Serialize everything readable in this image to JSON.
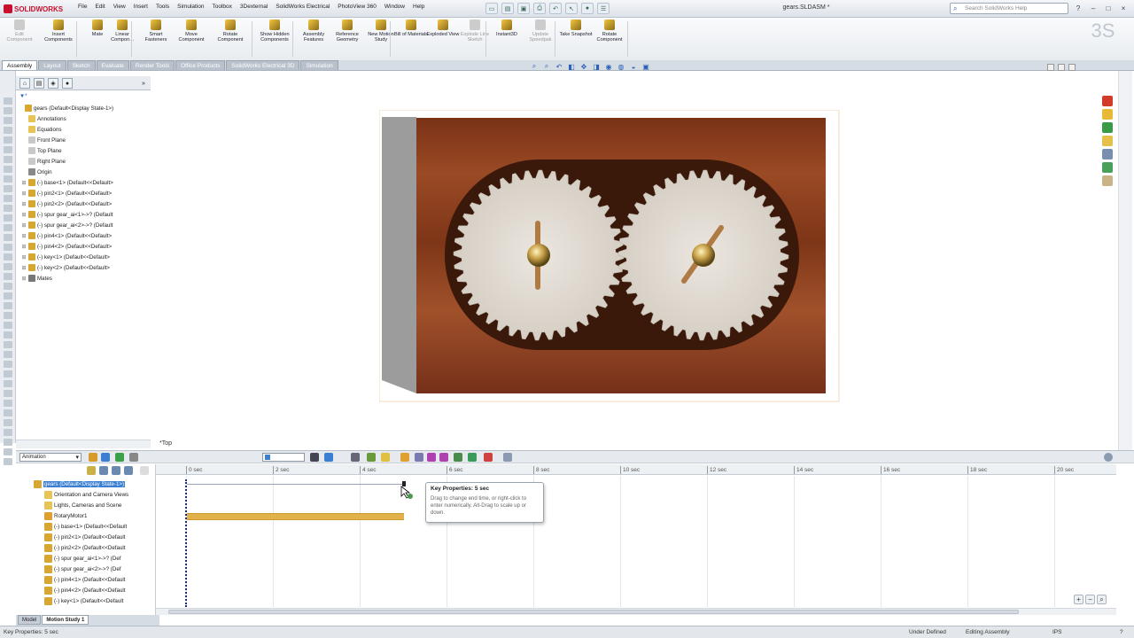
{
  "app": {
    "logo": "SOLIDWORKS",
    "menu": [
      "File",
      "Edit",
      "View",
      "Insert",
      "Tools",
      "Simulation",
      "Toolbox",
      "3Dexternal",
      "SolidWorks Electrical",
      "PhotoView 360",
      "Window",
      "Help"
    ],
    "document_title": "gears.SLDASM *",
    "search_placeholder": "Search SolidWorks Help"
  },
  "ribbon": {
    "buttons": [
      {
        "label": "Edit Component",
        "disabled": true
      },
      {
        "label": "Insert Components",
        "disabled": false
      },
      {
        "label": "Mate",
        "disabled": false
      },
      {
        "label": "Linear Compon...",
        "disabled": false
      },
      {
        "label": "Smart Fasteners",
        "disabled": false
      },
      {
        "label": "Move Component",
        "disabled": false
      },
      {
        "label": "Rotate Component",
        "disabled": false
      },
      {
        "label": "Show Hidden Components",
        "disabled": false
      },
      {
        "label": "Assembly Features",
        "disabled": false
      },
      {
        "label": "Reference Geometry",
        "disabled": false
      },
      {
        "label": "New Motion Study",
        "disabled": false
      },
      {
        "label": "Bill of Materials",
        "disabled": false
      },
      {
        "label": "Exploded View",
        "disabled": false
      },
      {
        "label": "Explode Line Sketch",
        "disabled": true
      },
      {
        "label": "Instant3D",
        "disabled": false
      },
      {
        "label": "Update Speedpak",
        "disabled": true
      },
      {
        "label": "Take Snapshot",
        "disabled": false
      },
      {
        "label": "Rotate Component",
        "disabled": false
      }
    ]
  },
  "tabs": [
    {
      "label": "Assembly",
      "active": true
    },
    {
      "label": "Layout",
      "active": false
    },
    {
      "label": "Sketch",
      "active": false
    },
    {
      "label": "Evaluate",
      "active": false
    },
    {
      "label": "Render Tools",
      "active": false
    },
    {
      "label": "Office Products",
      "active": false
    },
    {
      "label": "SolidWorks Electrical 3D",
      "active": false
    },
    {
      "label": "Simulation",
      "active": false
    }
  ],
  "feature_tree": {
    "filter": "▼*",
    "items": [
      {
        "label": "gears  (Default<Display State-1>)",
        "level": 0
      },
      {
        "label": "Annotations",
        "level": 1
      },
      {
        "label": "Equations",
        "level": 1
      },
      {
        "label": "Front Plane",
        "level": 1
      },
      {
        "label": "Top Plane",
        "level": 1
      },
      {
        "label": "Right Plane",
        "level": 1
      },
      {
        "label": "Origin",
        "level": 1
      },
      {
        "label": "(-) base<1> (Default<<Default>",
        "level": 1
      },
      {
        "label": "(-) pin2<1> (Default<<Default>",
        "level": 1
      },
      {
        "label": "(-) pin2<2> (Default<<Default>",
        "level": 1
      },
      {
        "label": "(-) spur gear_ai<1>->? (Default",
        "level": 1
      },
      {
        "label": "(-) spur gear_ai<2>->? (Default",
        "level": 1
      },
      {
        "label": "(-) pin4<1> (Default<<Default>",
        "level": 1
      },
      {
        "label": "(-) pin4<2> (Default<<Default>",
        "level": 1
      },
      {
        "label": "(-) key<1> (Default<<Default>",
        "level": 1
      },
      {
        "label": "(-) key<2> (Default<<Default>",
        "level": 1
      },
      {
        "label": "Mates",
        "level": 1
      }
    ]
  },
  "viewport": {
    "view_label": "*Top"
  },
  "motion_manager": {
    "study_type": "Animation",
    "ruler_ticks": [
      "0 sec",
      "2 sec",
      "4 sec",
      "6 sec",
      "8 sec",
      "10 sec",
      "12 sec",
      "14 sec",
      "16 sec",
      "18 sec",
      "20 sec"
    ],
    "tree": [
      "gears  (Default<Display State-1>)",
      "Orientation and Camera Views",
      "Lights, Cameras and Scene",
      "RotaryMotor1",
      "(-) base<1> (Default<<Default",
      "(-) pin2<1> (Default<<Default",
      "(-) pin2<2> (Default<<Default",
      "(-) spur gear_ai<1>->? (Def",
      "(-) spur gear_ai<2>->? (Def",
      "(-) pin4<1> (Default<<Default",
      "(-) pin4<2> (Default<<Default",
      "(-) key<1> (Default<<Default"
    ],
    "tooltip": {
      "title": "Key Properties: 5 sec",
      "body": "Drag to change end time, or right-click to enter numerically. Alt-Drag to scale up or down."
    },
    "motor_end_sec": 5,
    "bottom_tabs": [
      {
        "label": "Model",
        "active": false
      },
      {
        "label": "Motion Study 1",
        "active": true
      }
    ]
  },
  "status_bar": {
    "left": "Key Properties: 5 sec",
    "state": "Under Defined",
    "mode": "Editing Assembly",
    "units": "IPS"
  },
  "colors": {
    "accent": "#2a62b8",
    "wood": "#8b3a1c",
    "motor_bar": "#e3b14a"
  }
}
